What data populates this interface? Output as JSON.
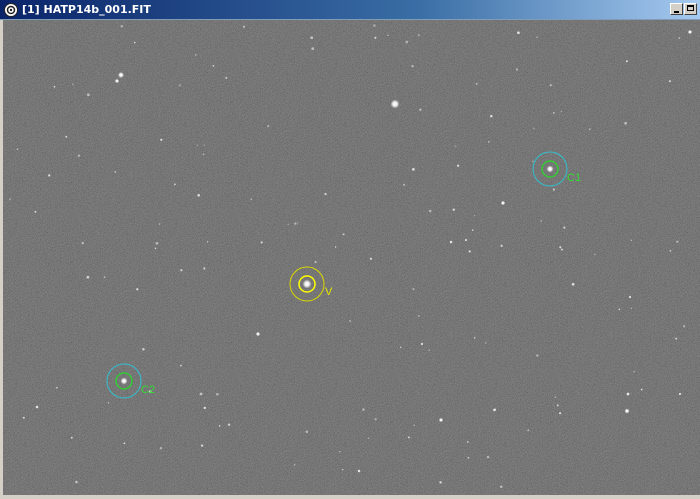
{
  "window": {
    "title": "[1] HATP14b_001.FIT"
  },
  "apertures": {
    "target": {
      "label": "V",
      "color": "#e6e600"
    },
    "comparisons": [
      {
        "label": "C1",
        "color": "#33cc33",
        "ring_color": "#33bfcf"
      },
      {
        "label": "C2",
        "color": "#33cc33",
        "ring_color": "#33bfcf"
      }
    ]
  },
  "colors": {
    "sky_background": "#4a4a4a",
    "titlebar": "#0a246a"
  },
  "icons": {
    "app": "telescope-icon",
    "minimize": "minimize-icon",
    "maximize": "maximize-icon"
  }
}
